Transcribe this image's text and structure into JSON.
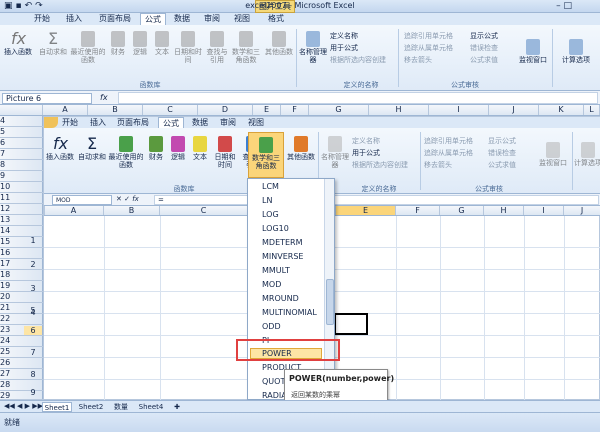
{
  "window": {
    "title": "excel2007 - Microsoft Excel",
    "context_tab": "图片工具",
    "format_tab": "格式"
  },
  "outer_tabs": [
    "开始",
    "插入",
    "页面布局",
    "公式",
    "数据",
    "审阅",
    "视图"
  ],
  "outer_ribbon": {
    "buttons": [
      "插入函数",
      "自动求和",
      "最近使用的函数",
      "财务",
      "逻辑",
      "文本",
      "日期和时间",
      "查找与引用",
      "数学和三角函数",
      "其他函数",
      "名称管理器"
    ],
    "group_label": "函数库",
    "define_names": [
      "定义名称",
      "用于公式",
      "根据所选内容创建"
    ],
    "define_label": "定义的名称",
    "audit": [
      "追踪引用单元格",
      "追踪从属单元格",
      "移去箭头",
      "显示公式",
      "错误检查",
      "公式求值"
    ],
    "audit_label": "公式审核",
    "watch": "监视窗口",
    "calc": "计算选项"
  },
  "outer_namebox": "Picture 6",
  "fx": "fx",
  "outer_cols": [
    "A",
    "B",
    "C",
    "D",
    "E",
    "F",
    "G",
    "H",
    "I",
    "J",
    "K",
    "L"
  ],
  "inner_tabs": [
    "开始",
    "插入",
    "页面布局",
    "公式",
    "数据",
    "审阅",
    "视图"
  ],
  "inner_ribbon": {
    "buttons": [
      "插入函数",
      "自动求和",
      "最近使用的函数",
      "财务",
      "逻辑",
      "文本",
      "日期和时间",
      "查找与引用",
      "数学和三角函数",
      "其他函数",
      "名称管理器"
    ],
    "group_label": "函数库",
    "define_names": [
      "定义名称",
      "用于公式",
      "根据所选内容创建"
    ],
    "define_label": "定义的名称",
    "audit": [
      "追踪引用单元格",
      "追踪从属单元格",
      "移去箭头",
      "显示公式",
      "错误检查",
      "公式求值"
    ],
    "audit_label": "公式审核",
    "watch": "监视窗口",
    "calc": "计算选项"
  },
  "inner_namebox": "MOD",
  "inner_formula": "=",
  "inner_cols": [
    "A",
    "B",
    "C",
    "D",
    "E",
    "F",
    "G",
    "H",
    "I",
    "J",
    "K"
  ],
  "rows": [
    {
      "outer": "4",
      "inner": ""
    },
    {
      "outer": "5",
      "inner": ""
    },
    {
      "outer": "6",
      "inner": ""
    },
    {
      "outer": "7",
      "inner": ""
    },
    {
      "outer": "8",
      "inner": ""
    },
    {
      "outer": "9",
      "inner": ""
    },
    {
      "outer": "10",
      "inner": ""
    },
    {
      "outer": "11",
      "inner": ""
    },
    {
      "outer": "12",
      "inner": "1"
    },
    {
      "outer": "13",
      "inner": ""
    },
    {
      "outer": "14",
      "inner": "2"
    },
    {
      "outer": "15",
      "inner": ""
    },
    {
      "outer": "16",
      "inner": "3"
    },
    {
      "outer": "17",
      "inner": ""
    },
    {
      "outer": "18",
      "inner": "4"
    },
    {
      "outer": "19",
      "inner": ""
    },
    {
      "outer": "20",
      "inner": "5"
    },
    {
      "outer": "21",
      "inner": ""
    },
    {
      "outer": "22",
      "inner": "5"
    },
    {
      "outer": "23",
      "inner": "6"
    },
    {
      "outer": "24",
      "inner": ""
    },
    {
      "outer": "25",
      "inner": "7"
    },
    {
      "outer": "26",
      "inner": ""
    },
    {
      "outer": "27",
      "inner": "8"
    },
    {
      "outer": "28",
      "inner": ""
    },
    {
      "outer": "29",
      "inner": "9"
    },
    {
      "outer": "30",
      "inner": ""
    },
    {
      "outer": "31",
      "inner": ""
    }
  ],
  "dropdown_items": [
    "LCM",
    "LN",
    "LOG",
    "LOG10",
    "MDETERM",
    "MINVERSE",
    "MMULT",
    "MOD",
    "MROUND",
    "MULTINOMIAL",
    "ODD",
    "PI",
    "POWER",
    "PRODUCT",
    "QUOTIENT",
    "RADIANS"
  ],
  "highlighted_item": "POWER",
  "tooltip": {
    "title": "POWER(number,power)",
    "desc": "返回某数的乘幂"
  },
  "sheet_tabs": [
    "Sheet1",
    "Sheet2",
    "数量",
    "Sheet4"
  ],
  "status": "就绪",
  "colors": {
    "highlight_box": "#e04040",
    "ribbon_blue": "#dbe8f7"
  }
}
